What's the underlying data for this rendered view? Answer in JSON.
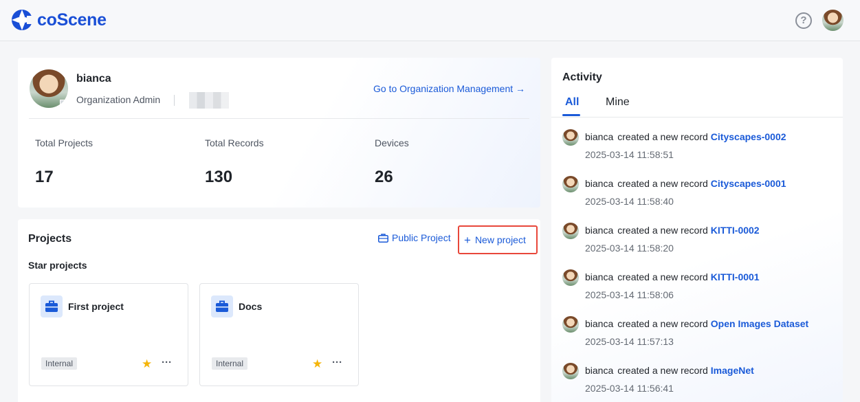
{
  "header": {
    "logo_text": "coScene",
    "help_icon": "question-circle-icon",
    "help_glyph": "?"
  },
  "profile": {
    "username": "bianca",
    "role": "Organization Admin",
    "org_link": "Go to Organization Management →",
    "stats": [
      {
        "label": "Total Projects",
        "value": "17"
      },
      {
        "label": "Total Records",
        "value": "130"
      },
      {
        "label": "Devices",
        "value": "26"
      }
    ]
  },
  "projects": {
    "title": "Projects",
    "public_label": "Public Project",
    "new_label": "New project",
    "new_glyph": "+",
    "star_title": "Star projects",
    "items": [
      {
        "name": "First project",
        "tag": "Internal",
        "star": "★",
        "more": "···"
      },
      {
        "name": "Docs",
        "tag": "Internal",
        "star": "★",
        "more": "···"
      }
    ]
  },
  "activity": {
    "title": "Activity",
    "tabs": [
      "All",
      "Mine"
    ],
    "active_tab": "All",
    "items": [
      {
        "user": "bianca",
        "action": "created a new record",
        "record": "Cityscapes-0002",
        "time": "2025-03-14 11:58:51"
      },
      {
        "user": "bianca",
        "action": "created a new record",
        "record": "Cityscapes-0001",
        "time": "2025-03-14 11:58:40"
      },
      {
        "user": "bianca",
        "action": "created a new record",
        "record": "KITTI-0002",
        "time": "2025-03-14 11:58:20"
      },
      {
        "user": "bianca",
        "action": "created a new record",
        "record": "KITTI-0001",
        "time": "2025-03-14 11:58:06"
      },
      {
        "user": "bianca",
        "action": "created a new record",
        "record": "Open Images Dataset",
        "time": "2025-03-14 11:57:13"
      },
      {
        "user": "bianca",
        "action": "created a new record",
        "record": "ImageNet",
        "time": "2025-03-14 11:56:41"
      }
    ]
  },
  "colors": {
    "brand": "#1a4fd6",
    "link": "#1a5ad8",
    "highlight_border": "#e8473a",
    "star": "#f5b50a"
  }
}
